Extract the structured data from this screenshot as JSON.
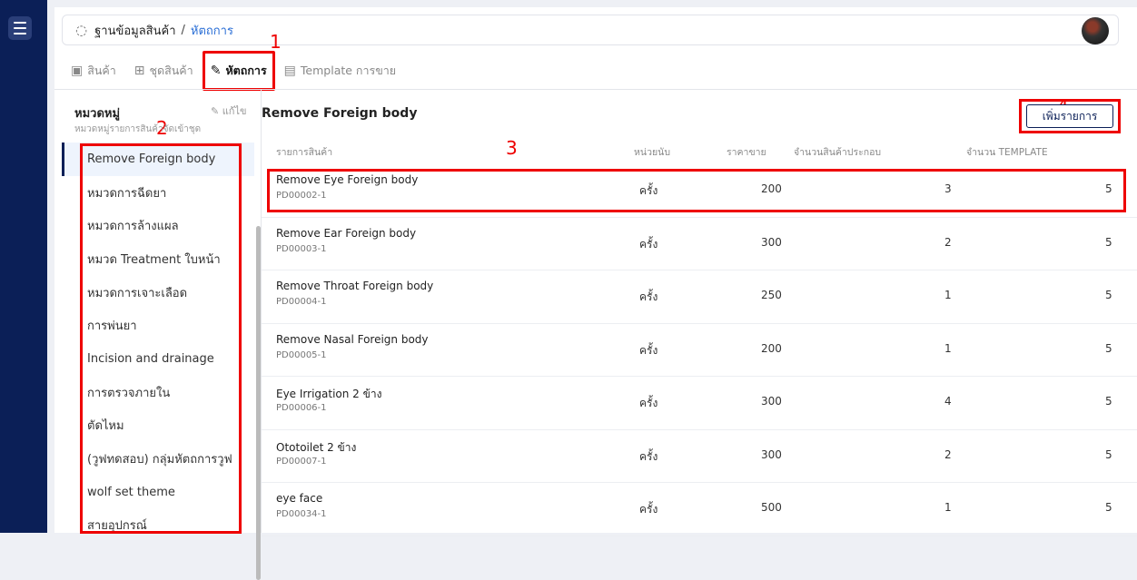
{
  "nav": {
    "menu_icon": "hamburger-icon"
  },
  "breadcrumb": {
    "root": "ฐานข้อมูลสินค้า",
    "separator": "/",
    "current": "หัตถการ"
  },
  "tabs": [
    {
      "label": "สินค้า",
      "icon": "product-icon"
    },
    {
      "label": "ชุดสินค้า",
      "icon": "bundle-icon"
    },
    {
      "label": "หัตถการ",
      "icon": "procedure-icon"
    },
    {
      "label": "Template การขาย",
      "icon": "template-icon"
    }
  ],
  "annotations": {
    "a1": "1",
    "a2": "2",
    "a3": "3",
    "a4": "4"
  },
  "category": {
    "title": "หมวดหมู่",
    "subtitle": "หมวดหมู่รายการสินค้าจัดเข้าชุด",
    "edit_label": "แก้ไข",
    "items": [
      "Remove Foreign body",
      "หมวดการฉีดยา",
      "หมวดการล้างแผล",
      "หมวด Treatment ใบหน้า",
      "หมวดการเจาะเลือด",
      "การพ่นยา",
      "Incision and drainage",
      "การตรวจภายใน",
      "ตัดไหม",
      "(วูฟทดสอบ) กลุ่มหัตถการวูฟ",
      "wolf set theme",
      "สายอุปกรณ์"
    ]
  },
  "section": {
    "title": "Remove Foreign body",
    "add_button": "เพิ่มรายการ"
  },
  "table": {
    "headers": {
      "item": "รายการสินค้า",
      "unit": "หน่วยนับ",
      "price": "ราคาขาย",
      "count": "จำนวนสินค้าประกอบ",
      "template": "จำนวน TEMPLATE"
    },
    "rows": [
      {
        "name": "Remove Eye Foreign body",
        "code": "PD00002-1",
        "unit": "ครั้ง",
        "price": "200",
        "count": "3",
        "template": "5"
      },
      {
        "name": "Remove Ear Foreign body",
        "code": "PD00003-1",
        "unit": "ครั้ง",
        "price": "300",
        "count": "2",
        "template": "5"
      },
      {
        "name": "Remove Throat Foreign body",
        "code": "PD00004-1",
        "unit": "ครั้ง",
        "price": "250",
        "count": "1",
        "template": "5"
      },
      {
        "name": "Remove Nasal Foreign body",
        "code": "PD00005-1",
        "unit": "ครั้ง",
        "price": "200",
        "count": "1",
        "template": "5"
      },
      {
        "name": "Eye Irrigation 2 ข้าง",
        "code": "PD00006-1",
        "unit": "ครั้ง",
        "price": "300",
        "count": "4",
        "template": "5"
      },
      {
        "name": "Ototoilet 2 ข้าง",
        "code": "PD00007-1",
        "unit": "ครั้ง",
        "price": "300",
        "count": "2",
        "template": "5"
      },
      {
        "name": "eye face",
        "code": "PD00034-1",
        "unit": "ครั้ง",
        "price": "500",
        "count": "1",
        "template": "5"
      }
    ]
  },
  "colors": {
    "sidebar": "#0b1f57",
    "accent": "#2b6fd6",
    "annotation": "#ee0000"
  }
}
